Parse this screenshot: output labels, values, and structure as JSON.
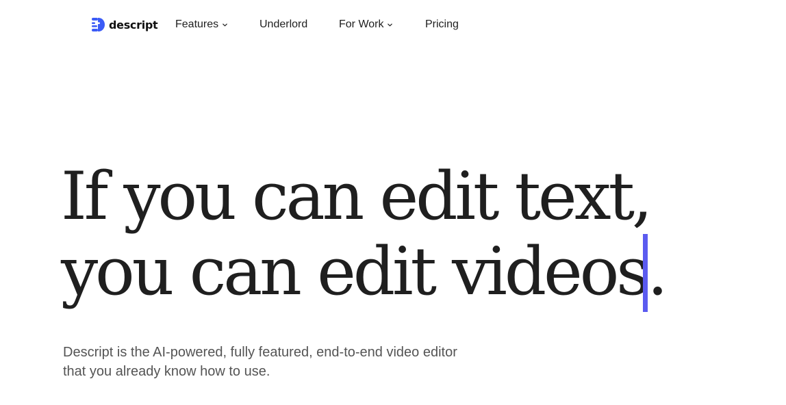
{
  "brand": {
    "name": "descript",
    "accent_color": "#3b5bf6",
    "icon": "descript-logo-icon"
  },
  "nav": {
    "items": [
      {
        "label": "Features",
        "has_dropdown": true,
        "icon": "chevron-down-icon"
      },
      {
        "label": "Underlord",
        "has_dropdown": false
      },
      {
        "label": "For Work",
        "has_dropdown": true,
        "icon": "chevron-down-icon"
      },
      {
        "label": "Pricing",
        "has_dropdown": false
      }
    ]
  },
  "hero": {
    "title_lines": [
      "If you can edit text,",
      "you can edit videos."
    ],
    "subtitle_lines": [
      "Descript is the AI-powered, fully featured, end-to-end video editor",
      "that you already know how to use."
    ],
    "caret_color": "#5b5bf0",
    "text_color": "#1f1f1f",
    "subtitle_color": "#545454"
  }
}
